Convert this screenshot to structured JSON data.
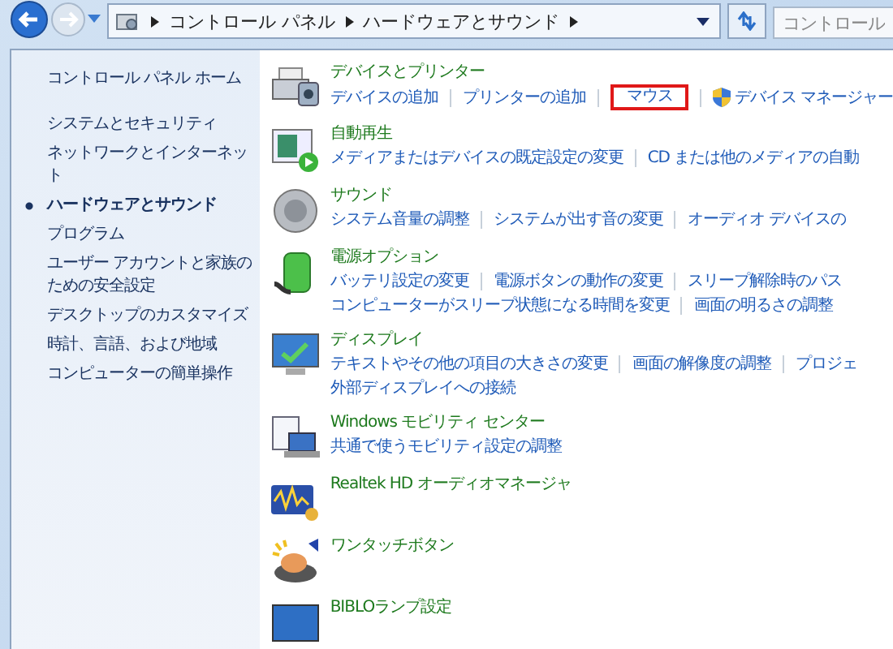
{
  "address_bar": {
    "path": [
      "コントロール パネル",
      "ハードウェアとサウンド"
    ],
    "search": {
      "placeholder": "コントロール"
    }
  },
  "sidebar": {
    "home": "コントロール パネル ホーム",
    "items": [
      {
        "label": "システムとセキュリティ",
        "selected": false
      },
      {
        "label": "ネットワークとインターネット",
        "selected": false
      },
      {
        "label": "ハードウェアとサウンド",
        "selected": true
      },
      {
        "label": "プログラム",
        "selected": false
      },
      {
        "label": "ユーザー アカウントと家族のための安全設定",
        "selected": false
      },
      {
        "label": "デスクトップのカスタマイズ",
        "selected": false
      },
      {
        "label": "時計、言語、および地域",
        "selected": false
      },
      {
        "label": "コンピューターの簡単操作",
        "selected": false
      }
    ]
  },
  "categories": [
    {
      "kind": "printer",
      "title": "デバイスとプリンター",
      "lines": [
        [
          {
            "label": "デバイスの追加",
            "highlighted": false,
            "shield": false
          },
          {
            "label": "プリンターの追加",
            "highlighted": false,
            "shield": false
          },
          {
            "label": "マウス",
            "highlighted": true,
            "shield": false
          },
          {
            "label": "デバイス マネージャー",
            "highlighted": false,
            "shield": true
          }
        ]
      ]
    },
    {
      "kind": "autoplay",
      "title": "自動再生",
      "lines": [
        [
          {
            "label": "メディアまたはデバイスの既定設定の変更",
            "highlighted": false,
            "shield": false
          },
          {
            "label": "CD または他のメディアの自動",
            "highlighted": false,
            "shield": false
          }
        ]
      ]
    },
    {
      "kind": "sound",
      "title": "サウンド",
      "lines": [
        [
          {
            "label": "システム音量の調整",
            "highlighted": false,
            "shield": false
          },
          {
            "label": "システムが出す音の変更",
            "highlighted": false,
            "shield": false
          },
          {
            "label": "オーディオ デバイスの",
            "highlighted": false,
            "shield": false
          }
        ]
      ]
    },
    {
      "kind": "power",
      "title": "電源オプション",
      "lines": [
        [
          {
            "label": "バッテリ設定の変更",
            "highlighted": false,
            "shield": false
          },
          {
            "label": "電源ボタンの動作の変更",
            "highlighted": false,
            "shield": false
          },
          {
            "label": "スリープ解除時のパス",
            "highlighted": false,
            "shield": false
          }
        ],
        [
          {
            "label": "コンピューターがスリープ状態になる時間を変更",
            "highlighted": false,
            "shield": false
          },
          {
            "label": "画面の明るさの調整",
            "highlighted": false,
            "shield": false
          }
        ]
      ]
    },
    {
      "kind": "display",
      "title": "ディスプレイ",
      "lines": [
        [
          {
            "label": "テキストやその他の項目の大きさの変更",
            "highlighted": false,
            "shield": false
          },
          {
            "label": "画面の解像度の調整",
            "highlighted": false,
            "shield": false
          },
          {
            "label": "プロジェ",
            "highlighted": false,
            "shield": false
          }
        ],
        [
          {
            "label": "外部ディスプレイへの接続",
            "highlighted": false,
            "shield": false
          }
        ]
      ]
    },
    {
      "kind": "mobility",
      "title": "Windows モビリティ センター",
      "lines": [
        [
          {
            "label": "共通で使うモビリティ設定の調整",
            "highlighted": false,
            "shield": false
          }
        ]
      ]
    },
    {
      "kind": "audio",
      "title": "Realtek HD オーディオマネージャ"
    },
    {
      "kind": "touch",
      "title": "ワンタッチボタン"
    },
    {
      "kind": "lamp",
      "title": "BIBLOランプ設定"
    }
  ]
}
